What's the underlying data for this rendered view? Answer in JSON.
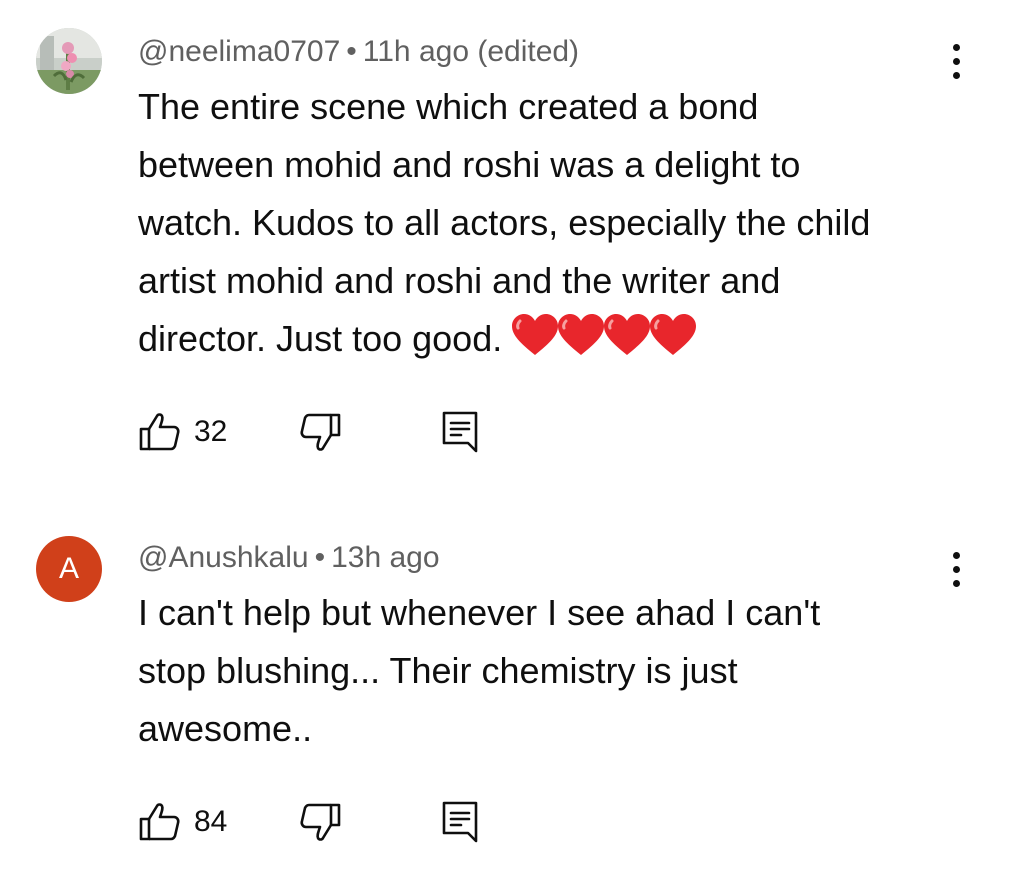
{
  "comments": [
    {
      "author": "@neelima0707",
      "separator": "•",
      "time": "11h ago (edited)",
      "text": "The entire scene which created a bond between mohid and roshi was a delight to watch. Kudos to all actors, especially the child artist mohid and roshi and the writer and director. Just too good.",
      "emoji": "❤️❤️❤️❤️",
      "avatar": "profile-photo",
      "likes": "32"
    },
    {
      "author": "@Anushkalu",
      "separator": "•",
      "time": "13h ago",
      "text": "I can't help but whenever I see ahad I can't stop blushing... Their chemistry is just awesome..",
      "avatar_letter": "A",
      "avatar_color": "#d0401a",
      "likes": "84"
    }
  ],
  "icons": {
    "like": "thumbs-up-icon",
    "dislike": "thumbs-down-icon",
    "reply": "comment-icon",
    "menu": "more-vertical-icon"
  },
  "colors": {
    "heart": "#e8262c",
    "meta": "#606060",
    "text": "#0f0f0f"
  }
}
